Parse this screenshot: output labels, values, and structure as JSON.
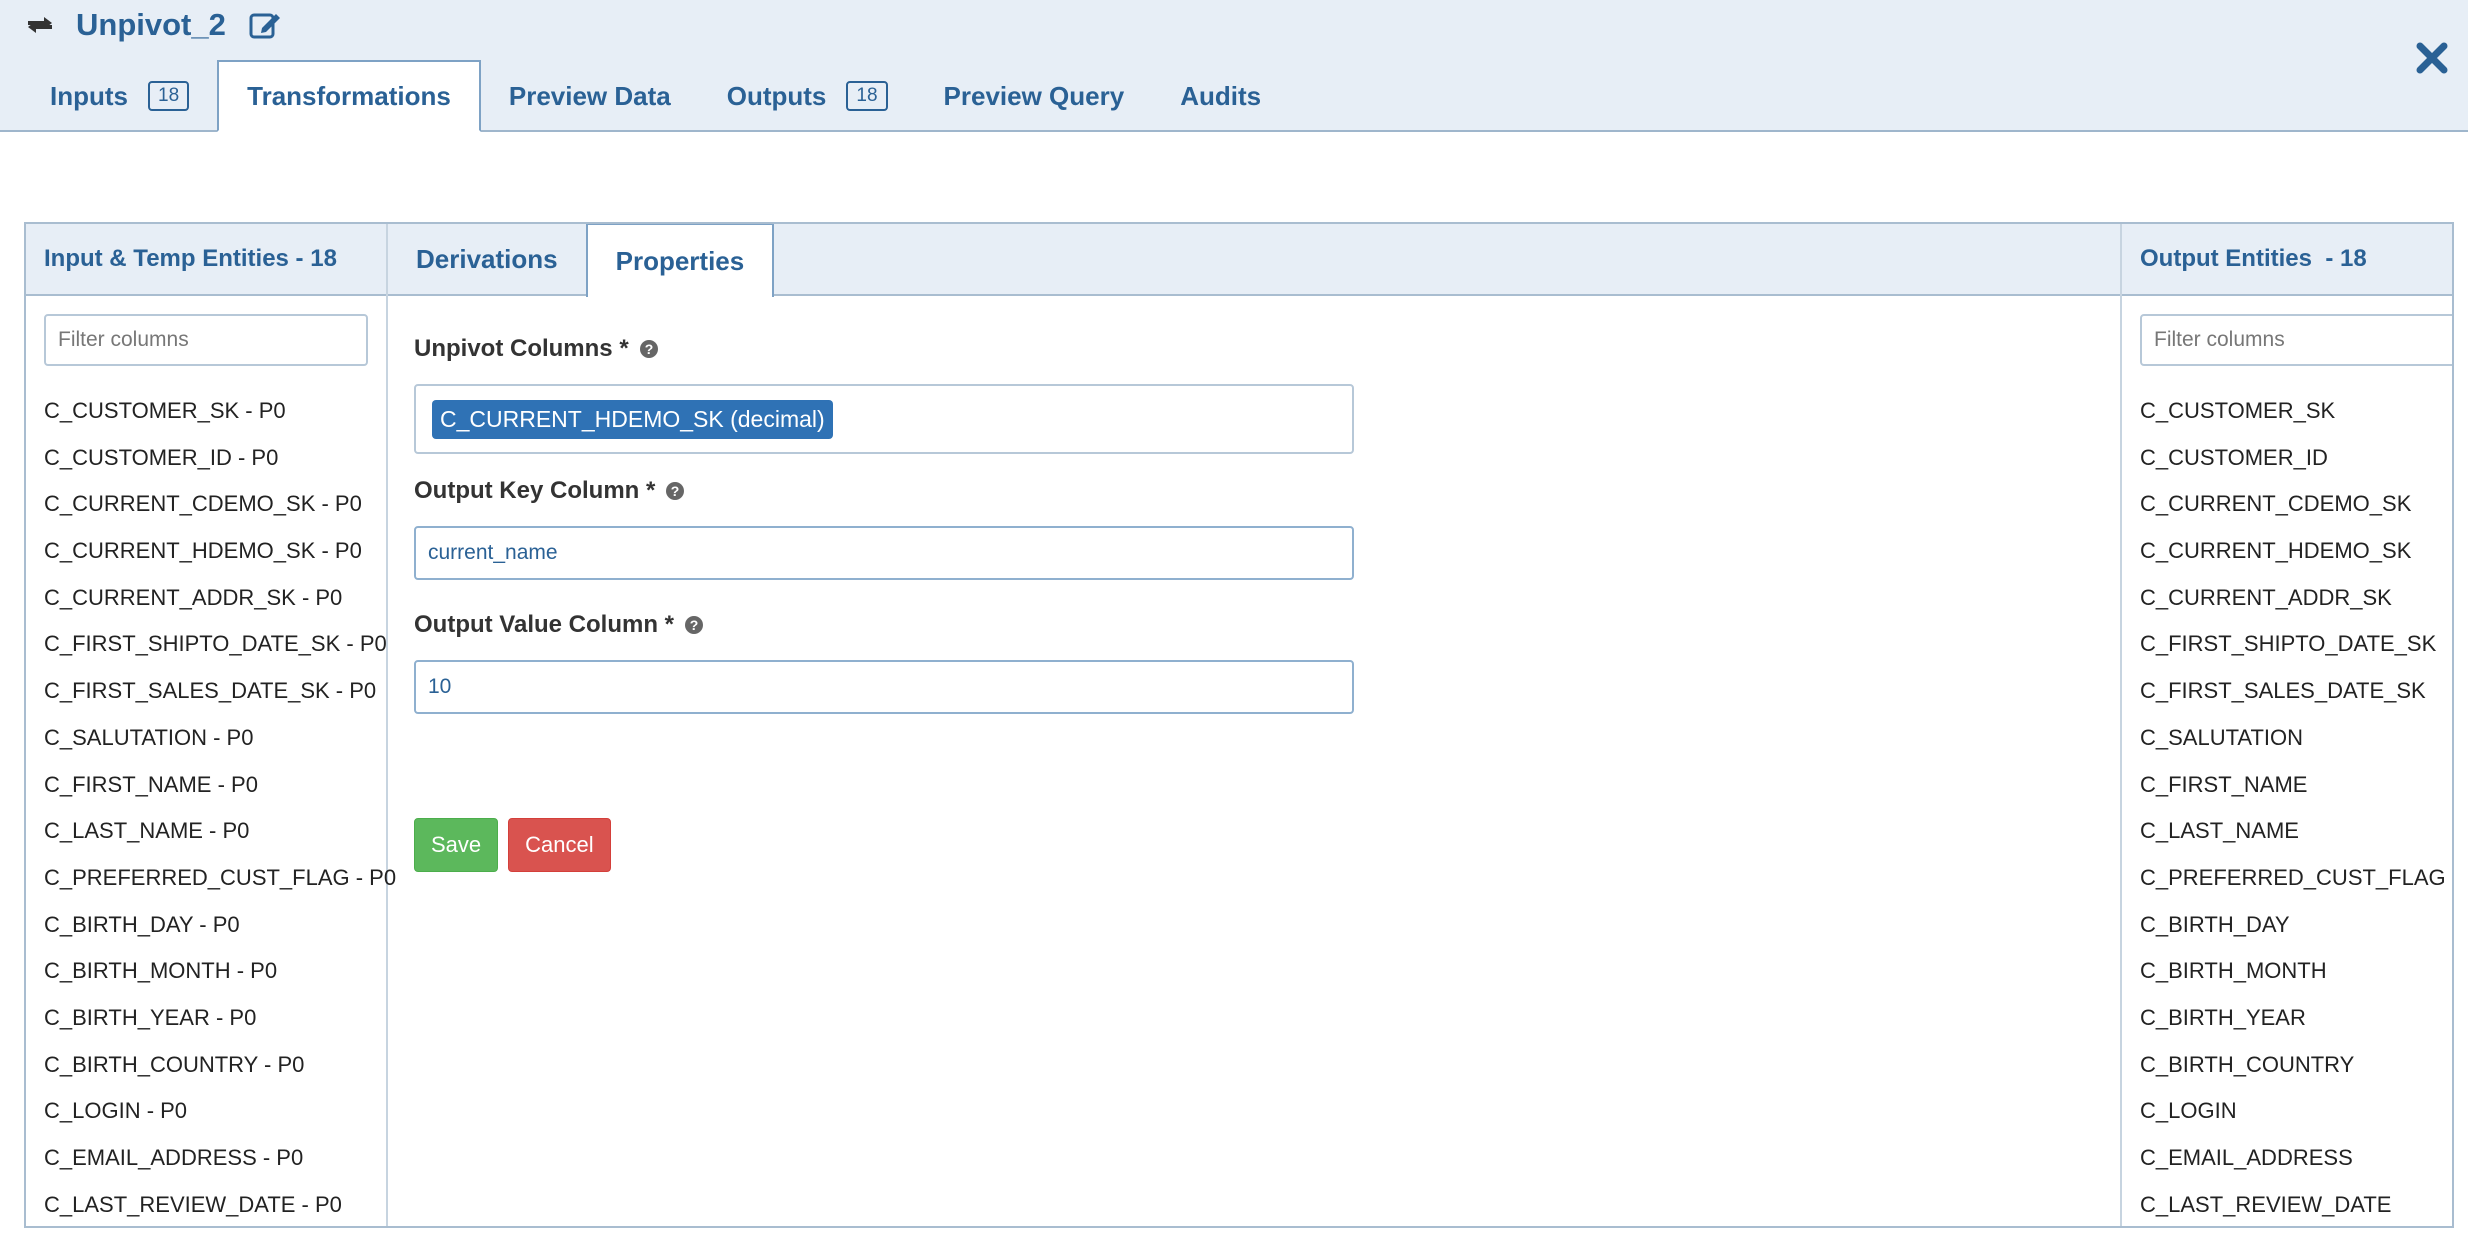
{
  "header": {
    "title": "Unpivot_2",
    "tabs": [
      {
        "label": "Inputs",
        "badge": "18"
      },
      {
        "label": "Transformations"
      },
      {
        "label": "Preview Data"
      },
      {
        "label": "Outputs",
        "badge": "18"
      },
      {
        "label": "Preview Query"
      },
      {
        "label": "Audits"
      }
    ],
    "active_tab": "Transformations"
  },
  "left_panel": {
    "title": "Input & Temp Entities - 18",
    "filter_placeholder": "Filter columns",
    "columns": [
      "C_CUSTOMER_SK - P0",
      "C_CUSTOMER_ID - P0",
      "C_CURRENT_CDEMO_SK - P0",
      "C_CURRENT_HDEMO_SK - P0",
      "C_CURRENT_ADDR_SK - P0",
      "C_FIRST_SHIPTO_DATE_SK - P0",
      "C_FIRST_SALES_DATE_SK - P0",
      "C_SALUTATION - P0",
      "C_FIRST_NAME - P0",
      "C_LAST_NAME - P0",
      "C_PREFERRED_CUST_FLAG - P0",
      "C_BIRTH_DAY - P0",
      "C_BIRTH_MONTH - P0",
      "C_BIRTH_YEAR - P0",
      "C_BIRTH_COUNTRY - P0",
      "C_LOGIN - P0",
      "C_EMAIL_ADDRESS - P0",
      "C_LAST_REVIEW_DATE - P0"
    ]
  },
  "center_panel": {
    "subtabs": [
      "Derivations",
      "Properties"
    ],
    "active_subtab": "Properties",
    "unpivot_label": "Unpivot Columns *",
    "unpivot_selected": "C_CURRENT_HDEMO_SK (decimal)",
    "key_label": "Output Key Column *",
    "key_value": "current_name",
    "value_label": "Output Value Column *",
    "value_value": "10",
    "save_label": "Save",
    "cancel_label": "Cancel"
  },
  "right_panel": {
    "title": "Output Entities  - 18",
    "filter_placeholder": "Filter columns",
    "columns": [
      "C_CUSTOMER_SK",
      "C_CUSTOMER_ID",
      "C_CURRENT_CDEMO_SK",
      "C_CURRENT_HDEMO_SK",
      "C_CURRENT_ADDR_SK",
      "C_FIRST_SHIPTO_DATE_SK",
      "C_FIRST_SALES_DATE_SK",
      "C_SALUTATION",
      "C_FIRST_NAME",
      "C_LAST_NAME",
      "C_PREFERRED_CUST_FLAG",
      "C_BIRTH_DAY",
      "C_BIRTH_MONTH",
      "C_BIRTH_YEAR",
      "C_BIRTH_COUNTRY",
      "C_LOGIN",
      "C_EMAIL_ADDRESS",
      "C_LAST_REVIEW_DATE"
    ]
  },
  "icons": {
    "title": "transform-icon",
    "edit": "edit-icon",
    "close": "close-icon",
    "help": "question-circle-icon"
  },
  "colors": {
    "accent": "#2a6195",
    "header_bg": "#e7eef6",
    "chip_bg": "#2f72b5",
    "save": "#5cb85c",
    "cancel": "#d9534f"
  }
}
